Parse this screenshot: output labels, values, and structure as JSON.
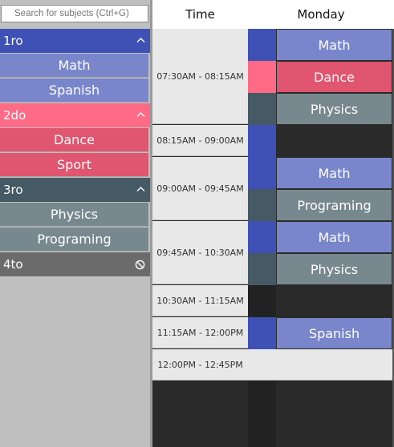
{
  "search": {
    "placeholder": "Search for subjects (Ctrl+G)"
  },
  "header": {
    "time": "Time",
    "day": "Monday"
  },
  "groups": [
    {
      "label": "1ro",
      "icon": "chevron-up-icon",
      "glyph": "^",
      "color": "#3f51b5",
      "subjects": [
        "Math",
        "Spanish"
      ],
      "subject_color": "#7986cb"
    },
    {
      "label": "2do",
      "icon": "chevron-up-icon",
      "glyph": "^",
      "color": "#ff6b86",
      "subjects": [
        "Dance",
        "Sport"
      ],
      "subject_color": "#e0556f"
    },
    {
      "label": "3ro",
      "icon": "chevron-up-icon",
      "glyph": "^",
      "color": "#455a64",
      "subjects": [
        "Physics",
        "Programing"
      ],
      "subject_color": "#78888f"
    },
    {
      "label": "4to",
      "icon": "blocked-icon",
      "glyph": "⃠",
      "color": "#6b6b6b",
      "subjects": [],
      "subject_color": ""
    }
  ],
  "time_slots": [
    "07:30AM - 08:15AM",
    "08:15AM - 09:00AM",
    "09:00AM - 09:45AM",
    "09:45AM - 10:30AM",
    "10:30AM - 11:15AM",
    "11:15AM - 12:00PM",
    "12:00PM - 12:45PM"
  ],
  "events": [
    {
      "subject": "Math",
      "group": "1ro"
    },
    {
      "subject": "Dance",
      "group": "2do"
    },
    {
      "subject": "Physics",
      "group": "3ro"
    },
    {
      "subject": "Math",
      "group": "1ro"
    },
    {
      "subject": "Programing",
      "group": "3ro"
    },
    {
      "subject": "Math",
      "group": "1ro"
    },
    {
      "subject": "Physics",
      "group": "3ro"
    },
    {
      "subject": "Spanish",
      "group": "1ro"
    }
  ]
}
